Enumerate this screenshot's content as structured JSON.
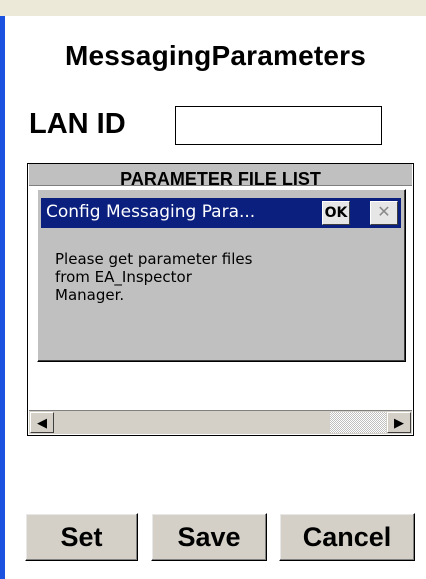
{
  "page": {
    "title": "MessagingParameters"
  },
  "lan_id": {
    "label": "LAN ID",
    "value": ""
  },
  "parameter_list": {
    "header": "PARAMETER FILE LIST",
    "scroll_left_glyph": "◀",
    "scroll_right_glyph": "▶"
  },
  "dialog": {
    "title": "Config Messaging Para...",
    "ok_label": "OK",
    "close_glyph": "✕",
    "message": "Please get parameter files\nfrom EA_Inspector\nManager."
  },
  "buttons": {
    "set": "Set",
    "save": "Save",
    "cancel": "Cancel"
  },
  "colors": {
    "titlebar": "#0a1f7e",
    "face": "#c0c0c0",
    "accent_bar": "#1c52e0"
  }
}
